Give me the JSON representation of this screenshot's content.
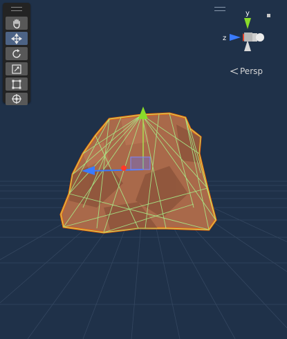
{
  "scene_view": {
    "projection_label": "Persp"
  },
  "gizmo": {
    "y_label": "y",
    "z_label": "z"
  },
  "toolbar": {
    "tools": [
      {
        "name": "view-tool",
        "icon": "hand-icon",
        "active": false
      },
      {
        "name": "move-tool",
        "icon": "move-arrows-icon",
        "active": true
      },
      {
        "name": "rotate-tool",
        "icon": "rotate-icon",
        "active": false
      },
      {
        "name": "scale-tool",
        "icon": "scale-icon",
        "active": false
      },
      {
        "name": "rect-tool",
        "icon": "rect-transform-icon",
        "active": false
      },
      {
        "name": "transform-tool",
        "icon": "transform-icon",
        "active": false
      }
    ]
  },
  "colors": {
    "background": "#1f3149",
    "grid": "#3a4d66",
    "mesh": "#b06b46",
    "wireframe": "#9cf07a",
    "outline": "#ff6a00",
    "axis_x": "#e8452c",
    "axis_y": "#8adb2a",
    "axis_z": "#3a7bff"
  }
}
